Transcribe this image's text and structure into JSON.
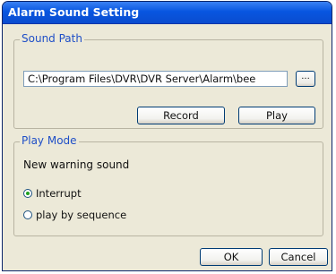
{
  "window": {
    "title": "Alarm Sound Setting"
  },
  "sound_path": {
    "group_label": "Sound Path",
    "path_value": "C:\\Program Files\\DVR\\DVR Server\\Alarm\\bee",
    "browse_label": "...",
    "record_label": "Record",
    "play_label": "Play"
  },
  "play_mode": {
    "group_label": "Play Mode",
    "subtitle": "New warning sound",
    "options": [
      {
        "label": "Interrupt",
        "selected": true
      },
      {
        "label": "play by sequence",
        "selected": false
      }
    ]
  },
  "footer": {
    "ok_label": "OK",
    "cancel_label": "Cancel"
  }
}
